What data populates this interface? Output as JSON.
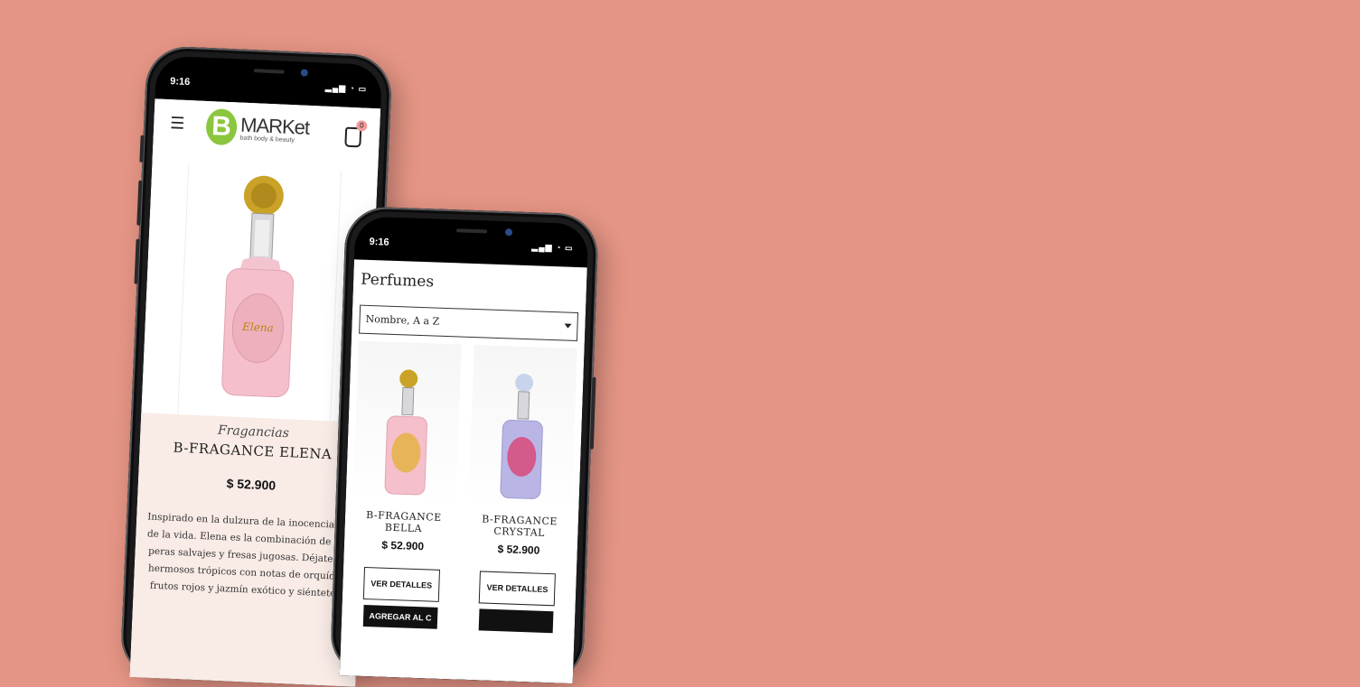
{
  "background_color": "#e59585",
  "phone1": {
    "status": {
      "time": "9:16",
      "icons": "signal-wifi-battery"
    },
    "header": {
      "logo_letter": "B",
      "logo_name": "MARKet",
      "logo_tagline": "bath body & beauty",
      "cart_count": "0"
    },
    "product": {
      "category": "Fragancias",
      "name": "B-FRAGANCE ELENA",
      "price": "$ 52.900",
      "description": "Inspirado en la dulzura de la inocencia y e de la vida. Elena es la combinación de per peras salvajes y fresas jugosas. Déjate lle hermosos trópicos con notas de orquídea frutos rojos y jazmín exótico y siéntete r"
    }
  },
  "phone2": {
    "status": {
      "time": "9:16",
      "icons": "signal-wifi-battery"
    },
    "page_title": "Perfumes",
    "sort": {
      "selected": "Nombre, A a Z"
    },
    "products": [
      {
        "name": "B-FRAGANCE BELLA",
        "price": "$ 52.900",
        "details_label": "VER DETALLES",
        "add_label": "AGREGAR AL C"
      },
      {
        "name": "B-FRAGANCE CRYSTAL",
        "price": "$ 52.900",
        "details_label": "VER DETALLES",
        "add_label": ""
      }
    ]
  },
  "colors": {
    "brand_green": "#8cc63f",
    "cart_badge": "#f29b9b",
    "info_panel": "#f9ece7"
  }
}
